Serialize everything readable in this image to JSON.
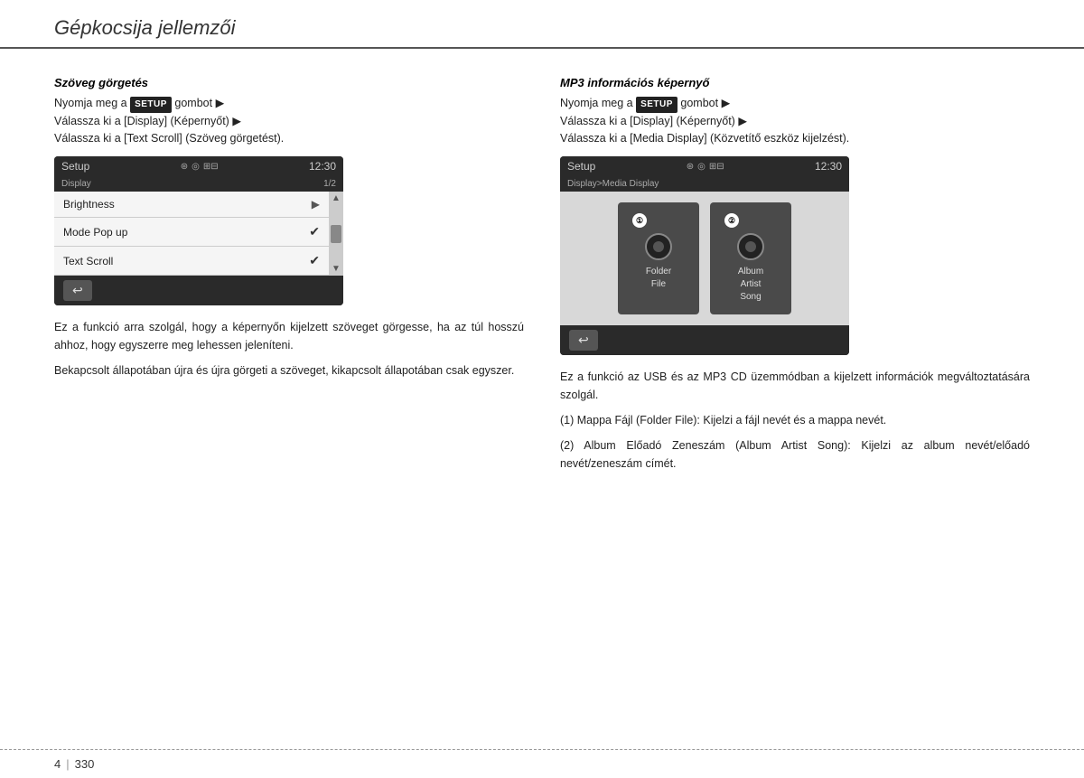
{
  "header": {
    "title": "Gépkocsija jellemzői"
  },
  "left_section": {
    "title": "Szöveg görgetés",
    "intro_line1": "Nyomja meg a",
    "setup_label": "SETUP",
    "intro_line2": "gombot",
    "intro_line3": "Válassza ki a [Display] (Képernyőt)",
    "intro_line4": "Válassza ki a [Text Scroll] (Szöveg görgetést).",
    "screen": {
      "title": "Setup",
      "time": "12:30",
      "subheader": "Display",
      "page": "1/2",
      "items": [
        {
          "label": "Brightness",
          "type": "arrow"
        },
        {
          "label": "Mode Pop up",
          "type": "check"
        },
        {
          "label": "Text Scroll",
          "type": "check"
        }
      ],
      "back_label": "↩"
    },
    "desc1": "Ez a funkció arra szolgál, hogy a képernyőn kijelzett szöveget görgesse, ha az túl hosszú ahhoz, hogy egyszerre meg lehessen jeleníteni.",
    "desc2": "Bekapcsolt állapotában újra és újra görgeti a szöveget, kikapcsolt állapotában csak egyszer."
  },
  "right_section": {
    "title": "MP3 információs képernyő",
    "intro_line1": "Nyomja meg a",
    "setup_label": "SETUP",
    "intro_line2": "gombot",
    "intro_line3": "Válassza ki a [Display] (Képernyőt)",
    "intro_line4": "Válassza ki a [Media Display] (Közvetítő eszköz kijelzést).",
    "screen": {
      "title": "Setup",
      "time": "12:30",
      "subheader": "Display>Media Display",
      "option1_number": "①",
      "option1_label": "Folder\nFile",
      "option2_number": "②",
      "option2_label": "Album\nArtist\nSong",
      "back_label": "↩"
    },
    "desc1": "Ez a funkció az USB és az MP3 CD üzemmódban a kijelzett információk megváltoztatására szolgál.",
    "desc2": "(1) Mappa Fájl (Folder File): Kijelzi a fájl nevét és a mappa nevét.",
    "desc3": "(2) Album Előadó Zeneszám (Album Artist Song): Kijelzi az album nevét/előadó nevét/zeneszám címét."
  },
  "footer": {
    "chapter": "4",
    "page": "330"
  }
}
